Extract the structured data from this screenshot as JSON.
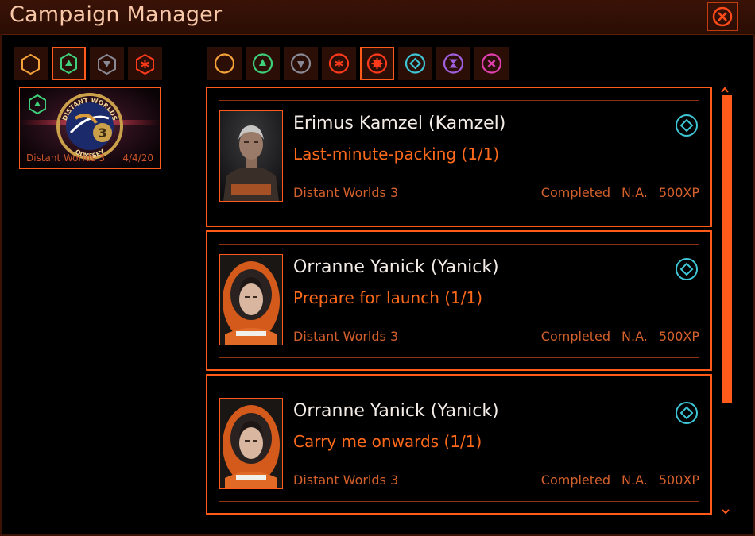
{
  "window": {
    "title": "Campaign Manager",
    "close_icon": "close-icon"
  },
  "colors": {
    "accent": "#ff5a1a",
    "titlebar": "#3a1206",
    "commander_name": "#f4ece6"
  },
  "left_filters": [
    {
      "icon": "hexagon-icon",
      "color": "#f5a23a",
      "selected": false
    },
    {
      "icon": "green-up-icon",
      "color": "#3ed07a",
      "selected": true
    },
    {
      "icon": "grey-down-icon",
      "color": "#8a8a96",
      "selected": false
    },
    {
      "icon": "red-star-icon",
      "color": "#ff3a1a",
      "selected": false
    }
  ],
  "right_filters": [
    {
      "icon": "orange-circle-icon",
      "color": "#f5a23a",
      "selected": false
    },
    {
      "icon": "green-up-icon",
      "color": "#3ed07a",
      "selected": false
    },
    {
      "icon": "grey-down-icon",
      "color": "#8a8a96",
      "selected": false
    },
    {
      "icon": "red-star-icon",
      "color": "#ff3a1a",
      "selected": false
    },
    {
      "icon": "red-cog-icon",
      "color": "#ff3a1a",
      "selected": true
    },
    {
      "icon": "cyan-diamond-icon",
      "color": "#3ec6d6",
      "selected": false
    },
    {
      "icon": "purple-hourglass-icon",
      "color": "#a060e0",
      "selected": false
    },
    {
      "icon": "magenta-x-icon",
      "color": "#e040b0",
      "selected": false
    }
  ],
  "campaign_card": {
    "name": "Distant Worlds 3",
    "date": "4/4/20",
    "logo_text_top": "DISTANT WORLDS",
    "logo_text_bottom": "ODYSSEY",
    "logo_number": "3"
  },
  "missions": [
    {
      "commander": "Erimus Kamzel (Kamzel)",
      "mission": "Last-minute-packing (1/1)",
      "campaign": "Distant Worlds 3",
      "status": "Completed",
      "na": "N.A.",
      "xp": "500XP",
      "portrait": "male"
    },
    {
      "commander": "Orranne Yanick (Yanick)",
      "mission": "Prepare for launch (1/1)",
      "campaign": "Distant Worlds 3",
      "status": "Completed",
      "na": "N.A.",
      "xp": "500XP",
      "portrait": "female"
    },
    {
      "commander": "Orranne Yanick (Yanick)",
      "mission": "Carry me onwards (1/1)",
      "campaign": "Distant Worlds 3",
      "status": "Completed",
      "na": "N.A.",
      "xp": "500XP",
      "portrait": "female"
    }
  ]
}
